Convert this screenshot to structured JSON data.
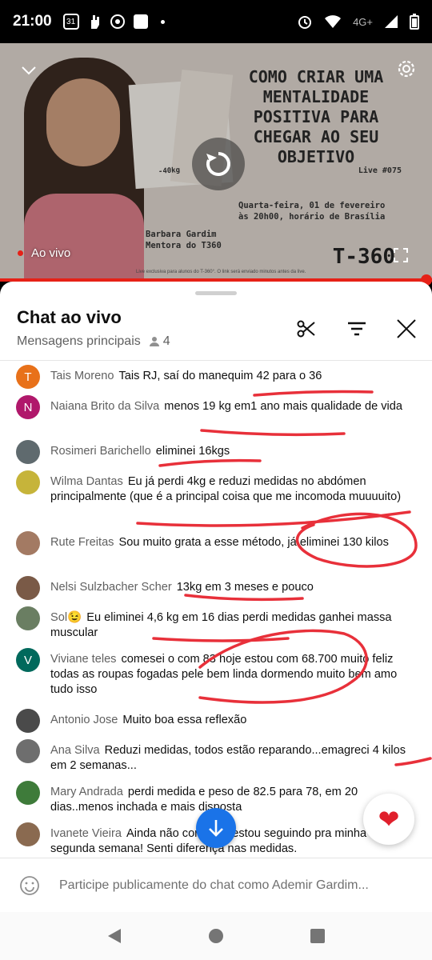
{
  "status_bar": {
    "time": "21:00",
    "calendar_day": "31",
    "network": "4G+"
  },
  "video": {
    "headline": "COMO CRIAR UMA\nMENTALIDADE\nPOSITIVA PARA\nCHEGAR AO SEU\nOBJETIVO",
    "live_number": "Live #075",
    "date_text": "Quarta-feira, 01 de fevereiro\nàs 20h00, horário de Brasília",
    "presenter": "Barbara Gardim\nMentora do T360",
    "brand": "T-360",
    "weight_caption": "-40kg",
    "footnote": "Live exclusiva para alunos do T-360°. O link será enviado minutos antes da live.",
    "live_label": "Ao vivo",
    "accent_color": "#e62117"
  },
  "chat": {
    "title": "Chat ao vivo",
    "subtitle": "Mensagens principais",
    "viewer_count": "4",
    "messages": [
      {
        "author": "Tais Moreno",
        "text": "Tais RJ, saí do manequim 42 para o 36",
        "initial": "T",
        "color": "#e8711a"
      },
      {
        "author": "Naiana Brito da Silva",
        "text": "menos 19 kg em1 ano mais qualidade de vida",
        "initial": "N",
        "color": "#b0186b"
      },
      {
        "author": "Rosimeri Barichello",
        "text": "eliminei 16kgs",
        "initial": "",
        "color": "#5f6a6e"
      },
      {
        "author": "Wilma Dantas",
        "text": "Eu já perdi 4kg e reduzi medidas no abdómen principalmente (que é a principal coisa que me incomoda muuuuito)",
        "initial": "",
        "color": "#c6b43a"
      },
      {
        "author": "Rute Freitas",
        "text": "Sou muito grata a esse método, já eliminei 130 kilos",
        "initial": "",
        "color": "#a37a63"
      },
      {
        "author": "Nelsi Sulzbacher Scher",
        "text": "13kg em 3 meses e pouco",
        "initial": "",
        "color": "#7a5a47"
      },
      {
        "author": "Sol😉",
        "text": "Eu eliminei 4,6 kg em 16 dias perdi medidas ganhei massa muscular",
        "initial": "",
        "color": "#6a7e62"
      },
      {
        "author": "Viviane teles",
        "text": "comesei o com 83 hoje estou com 68.700 muito feliz todas as roupas fogadas pele bem linda dormendo muito bem amo tudo isso",
        "initial": "V",
        "color": "#00695c"
      },
      {
        "author": "Antonio Jose",
        "text": "Muito boa essa reflexão",
        "initial": "",
        "color": "#4a4a4a"
      },
      {
        "author": "Ana Silva",
        "text": "Reduzi medidas, todos estão reparando...emagreci 4 kilos em 2 semanas...",
        "initial": "",
        "color": "#6e6e6e"
      },
      {
        "author": "Mary Andrada",
        "text": "perdi medida e peso de 82.5 para 78, em 20 dias..menos inchada e mais disposta",
        "initial": "",
        "color": "#3e7b3a"
      },
      {
        "author": "Ivanete Vieira",
        "text": "Ainda não comecei, estou seguindo pra minha segunda semana! Senti diferença nas medidas.",
        "initial": "",
        "color": "#8a6a50"
      }
    ],
    "input_placeholder": "Participe publicamente do chat como Ademir Gardim..."
  },
  "icons": {
    "collapse": "chevron-down-icon",
    "settings": "gear-icon",
    "replay": "replay-icon",
    "fullscreen": "fullscreen-icon",
    "clip": "scissors-icon",
    "filter": "filter-icon",
    "close": "close-icon",
    "emoji": "emoji-icon",
    "scroll_down": "arrow-down-icon",
    "heart": "heart-icon"
  }
}
